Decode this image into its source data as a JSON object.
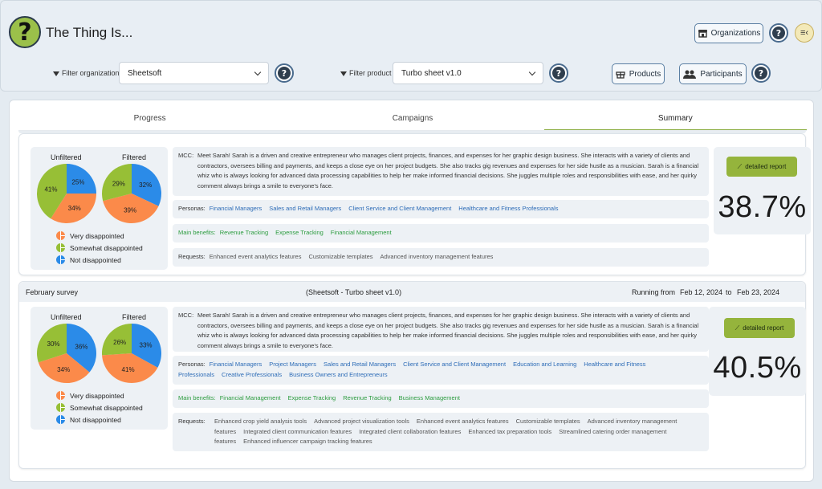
{
  "app": {
    "title": "The Thing Is..."
  },
  "header": {
    "organizations_label": "Organizations",
    "products_label": "Products",
    "participants_label": "Participants",
    "filter_org_label": "Filter organization",
    "filter_org_value": "Sheetsoft",
    "filter_product_label": "Filter product",
    "filter_product_value": "Turbo sheet v1.0"
  },
  "tabs": [
    {
      "label": "Progress"
    },
    {
      "label": "Campaigns"
    },
    {
      "label": "Summary"
    }
  ],
  "colors": {
    "very": "#fb8a4a",
    "somewhat": "#97bf36",
    "not": "#2b8be8",
    "accent": "#95b43c"
  },
  "legend": {
    "very": "Very disappointed",
    "somewhat": "Somewhat disappointed",
    "not": "Not disappointed"
  },
  "common": {
    "unfiltered": "Unfiltered",
    "filtered": "Filtered",
    "detailed_report": "detailed report",
    "mcc_key": "MCC:",
    "personas_key": "Personas:",
    "benefits_key": "Main benefits:",
    "requests_key": "Requests:"
  },
  "surveys": [
    {
      "mcc": "Meet Sarah! Sarah is a driven and creative entrepreneur who manages client projects, finances, and expenses for her graphic design business. She interacts with a variety of clients and contractors, oversees billing and payments, and keeps a close eye on her project budgets. She also tracks gig revenues and expenses for her side hustle as a musician. Sarah is a financial whiz who is always looking for advanced data processing capabilities to help her make informed financial decisions. She juggles multiple roles and responsibilities with ease, and her quirky comment always brings a smile to everyone's face.",
      "personas": [
        "Financial Managers",
        "Sales and Retail Managers",
        "Client Service and Client Management",
        "Healthcare and Fitness Professionals"
      ],
      "benefits": [
        "Revenue Tracking",
        "Expense Tracking",
        "Financial Management"
      ],
      "requests": [
        "Enhanced event analytics features",
        "Customizable templates",
        "Advanced inventory management features"
      ],
      "score": "38.7%",
      "unfiltered": {
        "very": 34,
        "somewhat": 41,
        "not": 25
      },
      "filtered": {
        "very": 39,
        "somewhat": 29,
        "not": 32
      }
    },
    {
      "name": "February survey",
      "product": "(Sheetsoft - Turbo sheet v1.0)",
      "running_label": "Running from",
      "start": "Feb 12, 2024",
      "to": "to",
      "end": "Feb 23, 2024",
      "mcc": "Meet Sarah! Sarah is a driven and creative entrepreneur who manages client projects, finances, and expenses for her graphic design business. She interacts with a variety of clients and contractors, oversees billing and payments, and keeps a close eye on her project budgets. She also tracks gig revenues and expenses for her side hustle as a musician. Sarah is a financial whiz who is always looking for advanced data processing capabilities to help her make informed financial decisions. She juggles multiple roles and responsibilities with ease, and her quirky comment always brings a smile to everyone's face.",
      "personas": [
        "Financial Managers",
        "Project Managers",
        "Sales and Retail Managers",
        "Client Service and Client Management",
        "Education and Learning",
        "Healthcare and Fitness Professionals",
        "Creative Professionals",
        "Business Owners and Entrepreneurs"
      ],
      "benefits": [
        "Financial Management",
        "Expense Tracking",
        "Revenue Tracking",
        "Business Management"
      ],
      "requests": [
        "Enhanced crop yield analysis tools",
        "Advanced project visualization tools",
        "Enhanced event analytics features",
        "Customizable templates",
        "Advanced inventory management features",
        "Integrated client communication features",
        "Integrated client collaboration features",
        "Enhanced tax preparation tools",
        "Streamlined catering order management features",
        "Enhanced influencer campaign tracking features"
      ],
      "score": "40.5%",
      "unfiltered": {
        "very": 34,
        "somewhat": 30,
        "not": 36
      },
      "filtered": {
        "very": 41,
        "somewhat": 26,
        "not": 33
      }
    }
  ]
}
